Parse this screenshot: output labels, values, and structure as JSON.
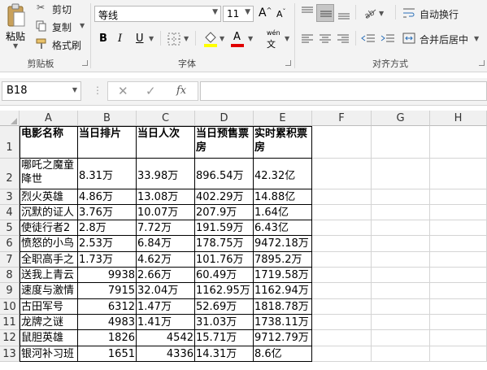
{
  "clipboard": {
    "paste": "粘贴",
    "cut": "剪切",
    "copy": "复制",
    "format_painter": "格式刷",
    "group_label": "剪贴板"
  },
  "font": {
    "name": "等线",
    "size": "11",
    "group_label": "字体",
    "bold": "B",
    "italic": "I",
    "underline": "U",
    "phonetic": "wén",
    "increase": "A",
    "decrease": "A",
    "font_color_letter": "A"
  },
  "alignment": {
    "wrap_text": "自动换行",
    "merge_center": "合并后居中",
    "group_label": "对齐方式"
  },
  "formula_bar": {
    "name_box": "B18",
    "fx": "fx",
    "value": ""
  },
  "columns": [
    "A",
    "B",
    "C",
    "D",
    "E",
    "F",
    "G",
    "H"
  ],
  "rows": [
    "1",
    "2",
    "3",
    "4",
    "5",
    "6",
    "7",
    "8",
    "9",
    "10",
    "11",
    "12",
    "13"
  ],
  "headers": [
    "电影名称",
    "当日排片",
    "当日人次",
    "当日预售票房",
    "实时累积票房"
  ],
  "table": [
    [
      "哪吒之魔童降世",
      "8.31万",
      "33.98万",
      "896.54万",
      "42.32亿"
    ],
    [
      "烈火英雄",
      "4.86万",
      "13.08万",
      "402.29万",
      "14.88亿"
    ],
    [
      "沉默的证人",
      "3.76万",
      "10.07万",
      "207.9万",
      "1.64亿"
    ],
    [
      "使徒行者2",
      "2.8万",
      "7.72万",
      "191.59万",
      "6.43亿"
    ],
    [
      "愤怒的小鸟",
      "2.53万",
      "6.84万",
      "178.75万",
      "9472.18万"
    ],
    [
      "全职高手之",
      "1.73万",
      "4.62万",
      "101.76万",
      "7895.2万"
    ],
    [
      "送我上青云",
      "9938",
      "2.66万",
      "60.49万",
      "1719.58万"
    ],
    [
      "速度与激情",
      "7915",
      "32.04万",
      "1162.95万",
      "1162.94万"
    ],
    [
      "古田军号",
      "6312",
      "1.47万",
      "52.69万",
      "1818.78万"
    ],
    [
      "龙牌之谜",
      "4983",
      "1.41万",
      "31.03万",
      "1738.11万"
    ],
    [
      "鼠胆英雄",
      "1826",
      "4542",
      "15.71万",
      "9712.79万"
    ],
    [
      "银河补习班",
      "1651",
      "4336",
      "14.31万",
      "8.6亿"
    ]
  ]
}
